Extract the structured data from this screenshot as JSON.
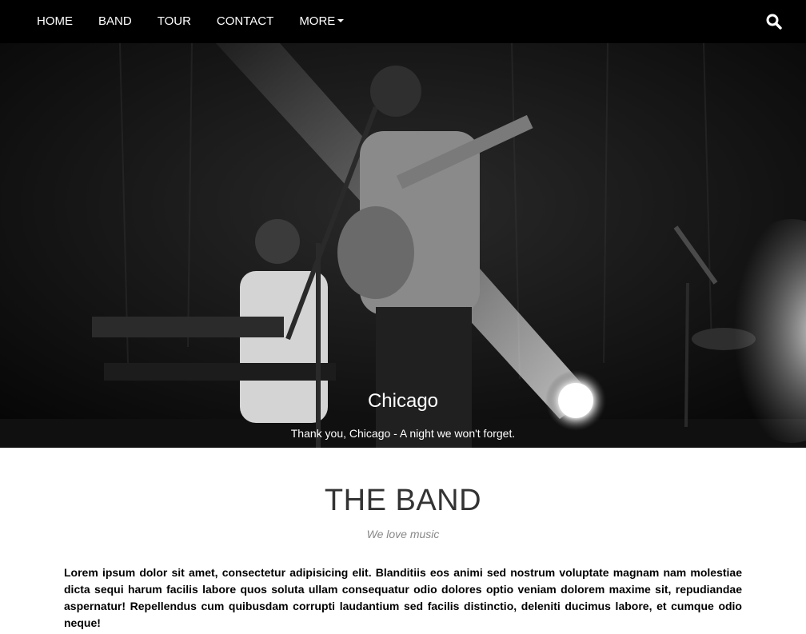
{
  "navbar": {
    "items": [
      {
        "label": "HOME"
      },
      {
        "label": "BAND"
      },
      {
        "label": "TOUR"
      },
      {
        "label": "CONTACT"
      },
      {
        "label": "MORE"
      }
    ],
    "search_icon": "search-icon"
  },
  "hero": {
    "title": "Chicago",
    "text": "Thank you, Chicago - A night we won't forget."
  },
  "band": {
    "title": "THE BAND",
    "subtitle": "We love music",
    "body": "Lorem ipsum dolor sit amet, consectetur adipisicing elit. Blanditiis eos animi sed nostrum voluptate magnam nam molestiae dicta sequi harum facilis labore quos soluta ullam consequatur odio dolores optio veniam dolorem maxime sit, repudiandae aspernatur! Repellendus cum quibusdam corrupti laudantium sed facilis distinctio, deleniti ducimus labore, et cumque odio neque!"
  },
  "colors": {
    "navbar": "#000000",
    "nav_text": "#ffffff",
    "heading": "#333333",
    "subtitle": "#888888"
  }
}
